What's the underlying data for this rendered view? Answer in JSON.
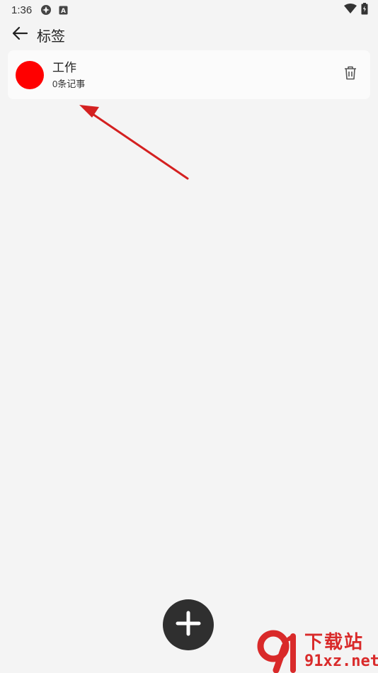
{
  "status_bar": {
    "time": "1:36",
    "icons": [
      "sync-icon",
      "a-badge-icon",
      "wifi-icon",
      "battery-icon"
    ]
  },
  "app_bar": {
    "back_icon": "arrow-left-icon",
    "title": "标签"
  },
  "tags": [
    {
      "name": "工作",
      "count_text": "0条记事",
      "color": "#ff0000",
      "delete_icon": "trash-icon"
    }
  ],
  "fab": {
    "icon": "plus-icon",
    "color": "#2f2f2f"
  },
  "annotation": {
    "type": "arrow",
    "color": "#d42020",
    "points_to": "tag-card"
  },
  "watermark": {
    "logo_text": "91",
    "top_text": "下载站",
    "bottom_text": "91xz.net",
    "color": "#d92a2a"
  }
}
